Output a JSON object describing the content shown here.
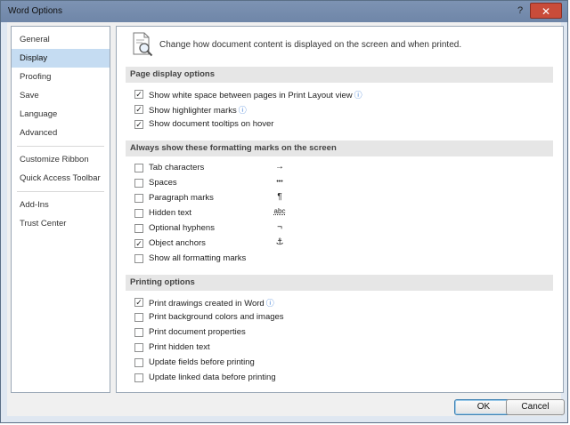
{
  "window": {
    "title": "Word Options",
    "help_glyph": "?",
    "close_glyph": "✕"
  },
  "sidebar": {
    "items": [
      {
        "label": "General"
      },
      {
        "label": "Display"
      },
      {
        "label": "Proofing"
      },
      {
        "label": "Save"
      },
      {
        "label": "Language"
      },
      {
        "label": "Advanced"
      },
      {
        "label": "Customize Ribbon"
      },
      {
        "label": "Quick Access Toolbar"
      },
      {
        "label": "Add-Ins"
      },
      {
        "label": "Trust Center"
      }
    ],
    "selected": "Display"
  },
  "main": {
    "header": "Change how document content is displayed on the screen and when printed.",
    "sections": [
      {
        "title": "Page display options",
        "options": [
          {
            "label": "Show white space between pages in Print Layout view",
            "checked": true,
            "info": true
          },
          {
            "label": "Show highlighter marks",
            "checked": true,
            "info": true
          },
          {
            "label": "Show document tooltips on hover",
            "checked": true,
            "info": false
          }
        ]
      },
      {
        "title": "Always show these formatting marks on the screen",
        "options": [
          {
            "label": "Tab characters",
            "checked": false,
            "mark": "→"
          },
          {
            "label": "Spaces",
            "checked": false,
            "mark": "•••"
          },
          {
            "label": "Paragraph marks",
            "checked": false,
            "mark": "¶"
          },
          {
            "label": "Hidden text",
            "checked": false,
            "mark": "abc"
          },
          {
            "label": "Optional hyphens",
            "checked": false,
            "mark": "¬"
          },
          {
            "label": "Object anchors",
            "checked": true,
            "mark": "⚓"
          },
          {
            "label": "Show all formatting marks",
            "checked": false
          }
        ]
      },
      {
        "title": "Printing options",
        "options": [
          {
            "label": "Print drawings created in Word",
            "checked": true,
            "info": true
          },
          {
            "label": "Print background colors and images",
            "checked": false
          },
          {
            "label": "Print document properties",
            "checked": false
          },
          {
            "label": "Print hidden text",
            "checked": false
          },
          {
            "label": "Update fields before printing",
            "checked": false
          },
          {
            "label": "Update linked data before printing",
            "checked": false
          }
        ]
      }
    ],
    "check_glyph": "✓",
    "info_glyph": "ⓘ"
  },
  "buttons": {
    "ok": "OK",
    "cancel": "Cancel"
  },
  "colors": {
    "selected_nav": "#c5dcf2",
    "section_bg": "#e6e6e6",
    "info": "#3a7bd5"
  }
}
